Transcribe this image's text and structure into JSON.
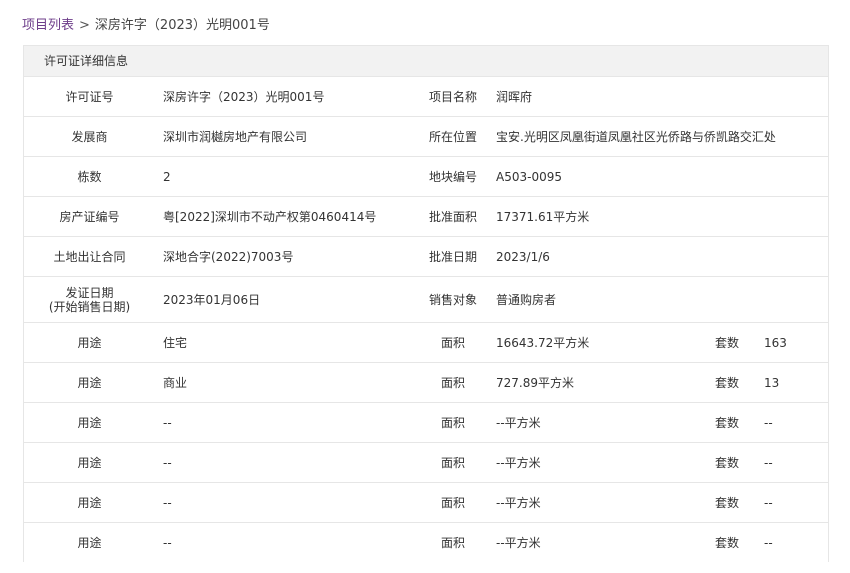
{
  "breadcrumb": {
    "root": "项目列表",
    "separator": ">",
    "current": "深房许字（2023）光明001号"
  },
  "panel": {
    "title": "许可证详细信息"
  },
  "info_rows": [
    {
      "l1": "许可证号",
      "v1": "深房许字（2023）光明001号",
      "l2": "项目名称",
      "v2": "润晖府"
    },
    {
      "l1": "发展商",
      "v1": "深圳市润樾房地产有限公司",
      "l2": "所在位置",
      "v2": "宝安.光明区凤凰街道凤凰社区光侨路与侨凯路交汇处"
    },
    {
      "l1": "栋数",
      "v1": "2",
      "l2": "地块编号",
      "v2": "A503-0095"
    },
    {
      "l1": "房产证编号",
      "v1": "粤[2022]深圳市不动产权第0460414号",
      "l2": "批准面积",
      "v2": "17371.61平方米"
    },
    {
      "l1": "土地出让合同",
      "v1": "深地合字(2022)7003号",
      "l2": "批准日期",
      "v2": "2023/1/6"
    }
  ],
  "issue_row": {
    "label_line1": "发证日期",
    "label_line2": "(开始销售日期)",
    "value": "2023年01月06日",
    "l2": "销售对象",
    "v2": "普通购房者"
  },
  "usage_rows": [
    {
      "l1": "用途",
      "v1": "住宅",
      "l2": "面积",
      "v2": "16643.72平方米",
      "l3": "套数",
      "v3": "163"
    },
    {
      "l1": "用途",
      "v1": "商业",
      "l2": "面积",
      "v2": "727.89平方米",
      "l3": "套数",
      "v3": "13"
    },
    {
      "l1": "用途",
      "v1": "--",
      "l2": "面积",
      "v2": "--平方米",
      "l3": "套数",
      "v3": "--"
    },
    {
      "l1": "用途",
      "v1": "--",
      "l2": "面积",
      "v2": "--平方米",
      "l3": "套数",
      "v3": "--"
    },
    {
      "l1": "用途",
      "v1": "--",
      "l2": "面积",
      "v2": "--平方米",
      "l3": "套数",
      "v3": "--"
    },
    {
      "l1": "用途",
      "v1": "--",
      "l2": "面积",
      "v2": "--平方米",
      "l3": "套数",
      "v3": "--"
    }
  ]
}
